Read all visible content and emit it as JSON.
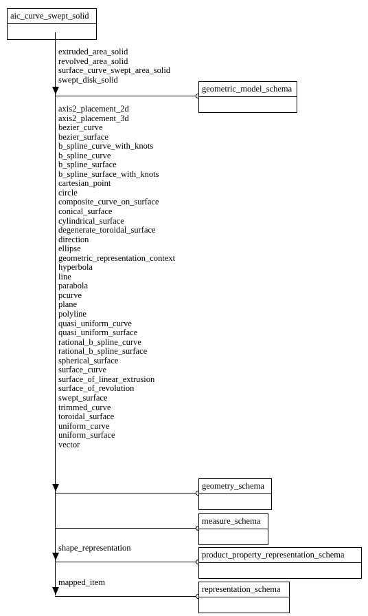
{
  "diagram": {
    "title": "aic_curve_swept_solid",
    "root_box": {
      "label": "aic_curve_swept_solid"
    },
    "groups": [
      {
        "name": "geometric_model_schema_group",
        "target_schema": "geometric_model_schema",
        "entities": [
          "extruded_area_solid",
          "revolved_area_solid",
          "surface_curve_swept_area_solid",
          "swept_disk_solid"
        ]
      },
      {
        "name": "geometry_schema_group",
        "target_schema": "geometry_schema",
        "entities": [
          "axis2_placement_2d",
          "axis2_placement_3d",
          "bezier_curve",
          "bezier_surface",
          "b_spline_curve_with_knots",
          "b_spline_curve",
          "b_spline_surface",
          "b_spline_surface_with_knots",
          "cartesian_point",
          "circle",
          "composite_curve_on_surface",
          "conical_surface",
          "cylindrical_surface",
          "degenerate_toroidal_surface",
          "direction",
          "ellipse",
          "geometric_representation_context",
          "hyperbola",
          "line",
          "parabola",
          "pcurve",
          "plane",
          "polyline",
          "quasi_uniform_curve",
          "quasi_uniform_surface",
          "rational_b_spline_curve",
          "rational_b_spline_surface",
          "spherical_surface",
          "surface_curve",
          "surface_of_linear_extrusion",
          "surface_of_revolution",
          "swept_surface",
          "trimmed_curve",
          "toroidal_surface",
          "uniform_curve",
          "uniform_surface",
          "vector"
        ]
      },
      {
        "name": "measure_schema_group",
        "target_schema": "measure_schema",
        "entities": []
      },
      {
        "name": "product_property_representation_schema_group",
        "target_schema": "product_property_representation_schema",
        "entities": [
          "shape_representation"
        ]
      },
      {
        "name": "representation_schema_group",
        "target_schema": "representation_schema",
        "entities": [
          "mapped_item"
        ]
      }
    ],
    "schema_boxes": [
      {
        "label": "geometric_model_schema"
      },
      {
        "label": "geometry_schema"
      },
      {
        "label": "measure_schema"
      },
      {
        "label": "product_property_representation_schema"
      },
      {
        "label": "representation_schema"
      }
    ]
  }
}
